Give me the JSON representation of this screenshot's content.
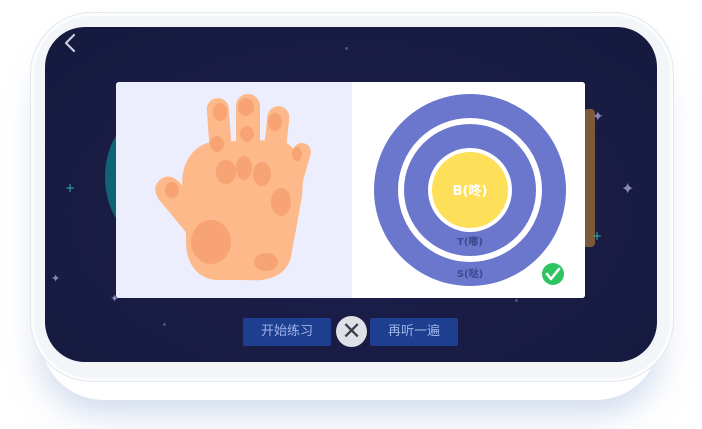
{
  "nav": {
    "back_icon": "chevron-left-icon"
  },
  "card": {
    "left_image": "hand-illustration",
    "target": {
      "inner_label": "B(咚)",
      "middle_label": "T(嘟)",
      "outer_label": "S(哒)",
      "colors": {
        "outer": "#6a77cc",
        "ring": "#ffffff",
        "inner": "#fddf5a",
        "label_dark": "#3b4a8c"
      },
      "status_icon": "check-circle-icon",
      "status_color": "#2ec45f"
    }
  },
  "buttons": {
    "start_label": "开始练习",
    "close_icon": "close-icon",
    "replay_label": "再听一遍"
  }
}
